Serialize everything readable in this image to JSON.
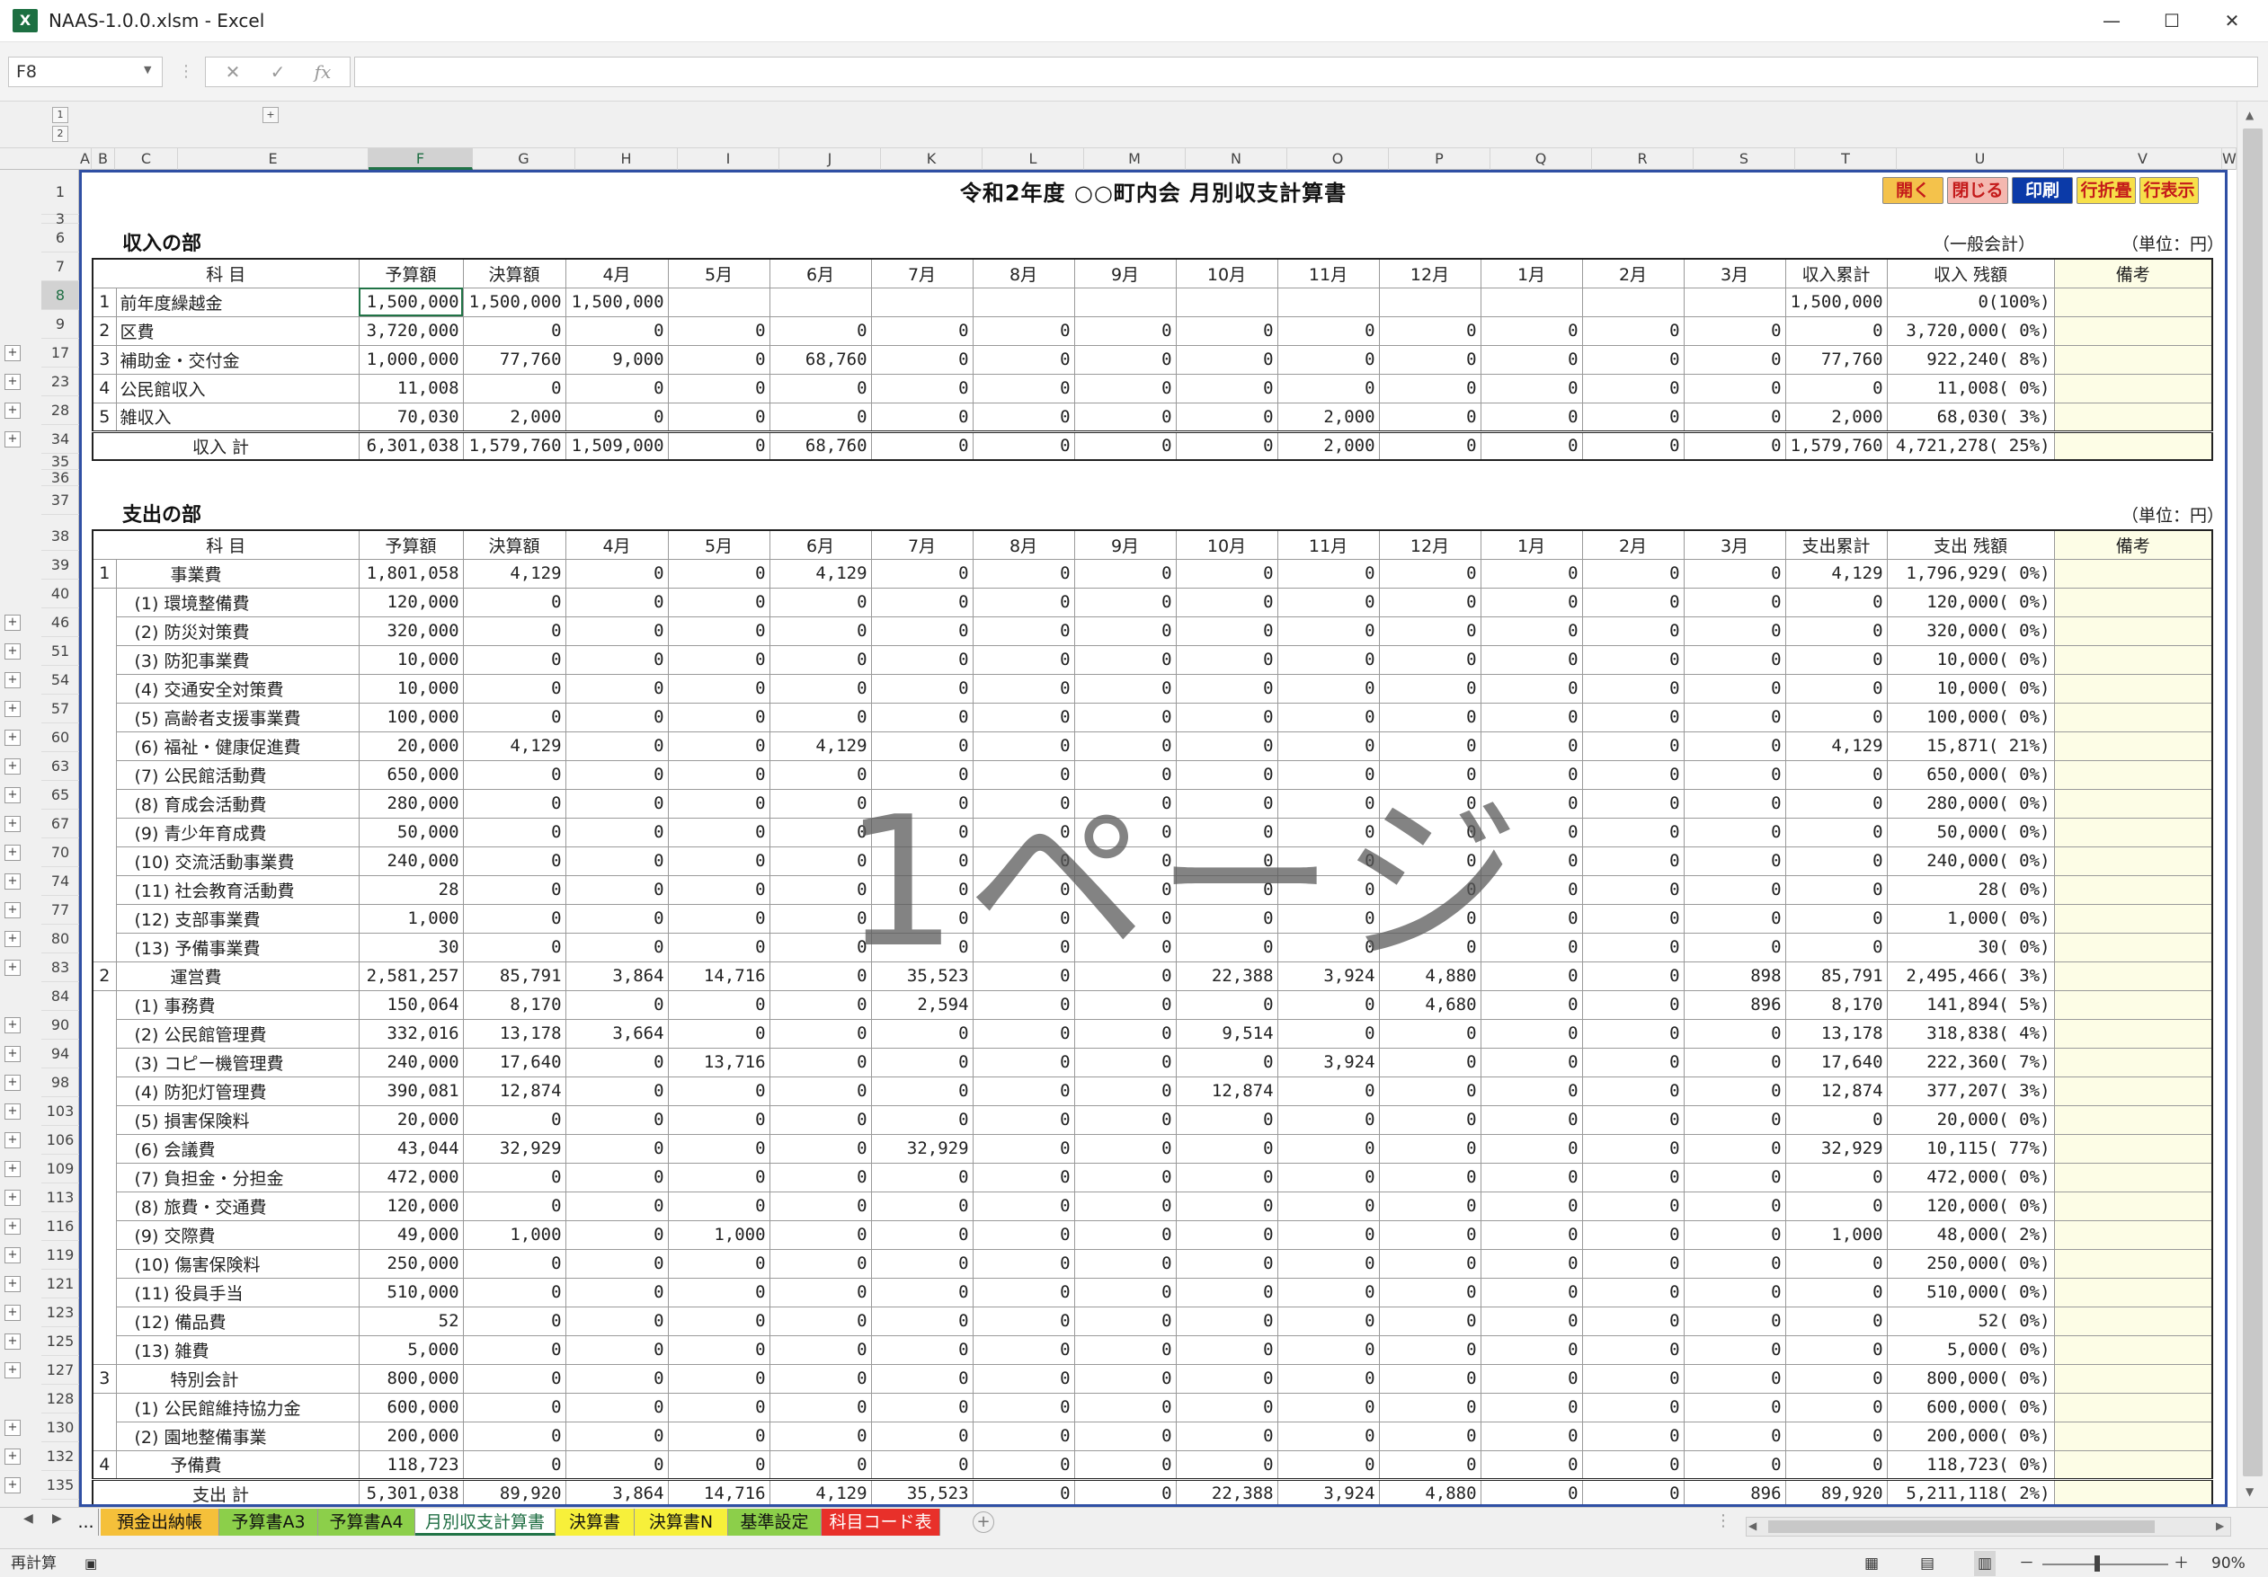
{
  "window": {
    "title": "NAAS-1.0.0.xlsm - Excel",
    "app_icon": "X",
    "minimize": "—",
    "maximize": "☐",
    "close": "✕"
  },
  "formula": {
    "namebox": "F8",
    "cancel": "✕",
    "enter": "✓",
    "fx": "fx",
    "value": ""
  },
  "outline": {
    "levels": [
      "1",
      "2"
    ],
    "col_plus": "+"
  },
  "columns": [
    "A",
    "B",
    "C",
    "E",
    "F",
    "G",
    "H",
    "I",
    "J",
    "K",
    "L",
    "M",
    "N",
    "O",
    "P",
    "Q",
    "R",
    "S",
    "T",
    "U",
    "V",
    "W"
  ],
  "selected_col": "F",
  "title": "令和2年度 ○○町内会 月別収支計算書",
  "macro_buttons": [
    {
      "label": "開く",
      "color": "#f4c24b",
      "text": "#c41a1a"
    },
    {
      "label": "閉じる",
      "color": "#f4b8b0",
      "text": "#c41a1a"
    },
    {
      "label": "印刷",
      "color": "#0b3aa8",
      "text": "#ffffff"
    },
    {
      "label": "行折畳",
      "color": "#f7e04a",
      "text": "#c41a1a"
    },
    {
      "label": "行表示",
      "color": "#f7e04a",
      "text": "#c41a1a"
    }
  ],
  "income": {
    "section": "収入の部",
    "account": "（一般会計）",
    "unit": "（単位：円）",
    "header": [
      "科 目",
      "予算額",
      "決算額",
      "4月",
      "5月",
      "6月",
      "7月",
      "8月",
      "9月",
      "10月",
      "11月",
      "12月",
      "1月",
      "2月",
      "3月",
      "収入累計",
      "収入 残額",
      "備考"
    ],
    "rows": [
      {
        "row": "8",
        "no": "1",
        "label": "前年度繰越金",
        "vals": [
          "1,500,000",
          "1,500,000",
          "1,500,000",
          "",
          "",
          "",
          "",
          "",
          "",
          "",
          "",
          "",
          "",
          ""
        ],
        "cum": "1,500,000",
        "rem": "0(100%)"
      },
      {
        "row": "9",
        "no": "2",
        "label": "区費",
        "vals": [
          "3,720,000",
          "0",
          "0",
          "0",
          "0",
          "0",
          "0",
          "0",
          "0",
          "0",
          "0",
          "0",
          "0",
          "0"
        ],
        "cum": "0",
        "rem": "3,720,000( 0%)"
      },
      {
        "row": "17",
        "no": "3",
        "label": "補助金・交付金",
        "vals": [
          "1,000,000",
          "77,760",
          "9,000",
          "0",
          "68,760",
          "0",
          "0",
          "0",
          "0",
          "0",
          "0",
          "0",
          "0",
          "0"
        ],
        "cum": "77,760",
        "rem": "922,240( 8%)"
      },
      {
        "row": "23",
        "no": "4",
        "label": "公民館収入",
        "vals": [
          "11,008",
          "0",
          "0",
          "0",
          "0",
          "0",
          "0",
          "0",
          "0",
          "0",
          "0",
          "0",
          "0",
          "0"
        ],
        "cum": "0",
        "rem": "11,008( 0%)"
      },
      {
        "row": "28",
        "no": "5",
        "label": "雑収入",
        "vals": [
          "70,030",
          "2,000",
          "0",
          "0",
          "0",
          "0",
          "0",
          "0",
          "0",
          "2,000",
          "0",
          "0",
          "0",
          "0"
        ],
        "cum": "2,000",
        "rem": "68,030( 3%)"
      }
    ],
    "total": {
      "row": "34",
      "label": "収入 計",
      "vals": [
        "6,301,038",
        "1,579,760",
        "1,509,000",
        "0",
        "68,760",
        "0",
        "0",
        "0",
        "0",
        "2,000",
        "0",
        "0",
        "0",
        "0"
      ],
      "cum": "1,579,760",
      "rem": "4,721,278( 25%)"
    }
  },
  "expense": {
    "section": "支出の部",
    "unit": "（単位：円）",
    "header": [
      "科 目",
      "予算額",
      "決算額",
      "4月",
      "5月",
      "6月",
      "7月",
      "8月",
      "9月",
      "10月",
      "11月",
      "12月",
      "1月",
      "2月",
      "3月",
      "支出累計",
      "支出 残額",
      "備考"
    ],
    "rows": [
      {
        "row": "39",
        "no": "1",
        "label": "事業費",
        "lvl": 0,
        "vals": [
          "1,801,058",
          "4,129",
          "0",
          "0",
          "4,129",
          "0",
          "0",
          "0",
          "0",
          "0",
          "0",
          "0",
          "0",
          "0"
        ],
        "cum": "4,129",
        "rem": "1,796,929( 0%)"
      },
      {
        "row": "40",
        "no": "",
        "label": "(1) 環境整備費",
        "lvl": 1,
        "vals": [
          "120,000",
          "0",
          "0",
          "0",
          "0",
          "0",
          "0",
          "0",
          "0",
          "0",
          "0",
          "0",
          "0",
          "0"
        ],
        "cum": "0",
        "rem": "120,000( 0%)"
      },
      {
        "row": "46",
        "no": "",
        "label": "(2) 防災対策費",
        "lvl": 1,
        "vals": [
          "320,000",
          "0",
          "0",
          "0",
          "0",
          "0",
          "0",
          "0",
          "0",
          "0",
          "0",
          "0",
          "0",
          "0"
        ],
        "cum": "0",
        "rem": "320,000( 0%)"
      },
      {
        "row": "51",
        "no": "",
        "label": "(3) 防犯事業費",
        "lvl": 1,
        "vals": [
          "10,000",
          "0",
          "0",
          "0",
          "0",
          "0",
          "0",
          "0",
          "0",
          "0",
          "0",
          "0",
          "0",
          "0"
        ],
        "cum": "0",
        "rem": "10,000( 0%)"
      },
      {
        "row": "54",
        "no": "",
        "label": "(4) 交通安全対策費",
        "lvl": 1,
        "vals": [
          "10,000",
          "0",
          "0",
          "0",
          "0",
          "0",
          "0",
          "0",
          "0",
          "0",
          "0",
          "0",
          "0",
          "0"
        ],
        "cum": "0",
        "rem": "10,000( 0%)"
      },
      {
        "row": "57",
        "no": "",
        "label": "(5) 高齢者支援事業費",
        "lvl": 1,
        "vals": [
          "100,000",
          "0",
          "0",
          "0",
          "0",
          "0",
          "0",
          "0",
          "0",
          "0",
          "0",
          "0",
          "0",
          "0"
        ],
        "cum": "0",
        "rem": "100,000( 0%)"
      },
      {
        "row": "60",
        "no": "",
        "label": "(6) 福祉・健康促進費",
        "lvl": 1,
        "vals": [
          "20,000",
          "4,129",
          "0",
          "0",
          "4,129",
          "0",
          "0",
          "0",
          "0",
          "0",
          "0",
          "0",
          "0",
          "0"
        ],
        "cum": "4,129",
        "rem": "15,871( 21%)"
      },
      {
        "row": "63",
        "no": "",
        "label": "(7) 公民館活動費",
        "lvl": 1,
        "vals": [
          "650,000",
          "0",
          "0",
          "0",
          "0",
          "0",
          "0",
          "0",
          "0",
          "0",
          "0",
          "0",
          "0",
          "0"
        ],
        "cum": "0",
        "rem": "650,000( 0%)"
      },
      {
        "row": "65",
        "no": "",
        "label": "(8) 育成会活動費",
        "lvl": 1,
        "vals": [
          "280,000",
          "0",
          "0",
          "0",
          "0",
          "0",
          "0",
          "0",
          "0",
          "0",
          "0",
          "0",
          "0",
          "0"
        ],
        "cum": "0",
        "rem": "280,000( 0%)"
      },
      {
        "row": "67",
        "no": "",
        "label": "(9) 青少年育成費",
        "lvl": 1,
        "vals": [
          "50,000",
          "0",
          "0",
          "0",
          "0",
          "0",
          "0",
          "0",
          "0",
          "0",
          "0",
          "0",
          "0",
          "0"
        ],
        "cum": "0",
        "rem": "50,000( 0%)"
      },
      {
        "row": "70",
        "no": "",
        "label": "(10) 交流活動事業費",
        "lvl": 1,
        "vals": [
          "240,000",
          "0",
          "0",
          "0",
          "0",
          "0",
          "0",
          "0",
          "0",
          "0",
          "0",
          "0",
          "0",
          "0"
        ],
        "cum": "0",
        "rem": "240,000( 0%)"
      },
      {
        "row": "74",
        "no": "",
        "label": "(11) 社会教育活動費",
        "lvl": 1,
        "vals": [
          "28",
          "0",
          "0",
          "0",
          "0",
          "0",
          "0",
          "0",
          "0",
          "0",
          "0",
          "0",
          "0",
          "0"
        ],
        "cum": "0",
        "rem": "28( 0%)"
      },
      {
        "row": "77",
        "no": "",
        "label": "(12) 支部事業費",
        "lvl": 1,
        "vals": [
          "1,000",
          "0",
          "0",
          "0",
          "0",
          "0",
          "0",
          "0",
          "0",
          "0",
          "0",
          "0",
          "0",
          "0"
        ],
        "cum": "0",
        "rem": "1,000( 0%)"
      },
      {
        "row": "80",
        "no": "",
        "label": "(13) 予備事業費",
        "lvl": 1,
        "vals": [
          "30",
          "0",
          "0",
          "0",
          "0",
          "0",
          "0",
          "0",
          "0",
          "0",
          "0",
          "0",
          "0",
          "0"
        ],
        "cum": "0",
        "rem": "30( 0%)"
      },
      {
        "row": "83",
        "no": "2",
        "label": "運営費",
        "lvl": 0,
        "vals": [
          "2,581,257",
          "85,791",
          "3,864",
          "14,716",
          "0",
          "35,523",
          "0",
          "0",
          "22,388",
          "3,924",
          "4,880",
          "0",
          "0",
          "898"
        ],
        "cum": "85,791",
        "rem": "2,495,466( 3%)"
      },
      {
        "row": "84",
        "no": "",
        "label": "(1) 事務費",
        "lvl": 1,
        "vals": [
          "150,064",
          "8,170",
          "0",
          "0",
          "0",
          "2,594",
          "0",
          "0",
          "0",
          "0",
          "4,680",
          "0",
          "0",
          "896"
        ],
        "cum": "8,170",
        "rem": "141,894( 5%)"
      },
      {
        "row": "90",
        "no": "",
        "label": "(2) 公民館管理費",
        "lvl": 1,
        "vals": [
          "332,016",
          "13,178",
          "3,664",
          "0",
          "0",
          "0",
          "0",
          "0",
          "9,514",
          "0",
          "0",
          "0",
          "0",
          "0"
        ],
        "cum": "13,178",
        "rem": "318,838( 4%)"
      },
      {
        "row": "94",
        "no": "",
        "label": "(3) コピー機管理費",
        "lvl": 1,
        "vals": [
          "240,000",
          "17,640",
          "0",
          "13,716",
          "0",
          "0",
          "0",
          "0",
          "0",
          "3,924",
          "0",
          "0",
          "0",
          "0"
        ],
        "cum": "17,640",
        "rem": "222,360( 7%)"
      },
      {
        "row": "98",
        "no": "",
        "label": "(4) 防犯灯管理費",
        "lvl": 1,
        "vals": [
          "390,081",
          "12,874",
          "0",
          "0",
          "0",
          "0",
          "0",
          "0",
          "12,874",
          "0",
          "0",
          "0",
          "0",
          "0"
        ],
        "cum": "12,874",
        "rem": "377,207( 3%)"
      },
      {
        "row": "103",
        "no": "",
        "label": "(5) 損害保険料",
        "lvl": 1,
        "vals": [
          "20,000",
          "0",
          "0",
          "0",
          "0",
          "0",
          "0",
          "0",
          "0",
          "0",
          "0",
          "0",
          "0",
          "0"
        ],
        "cum": "0",
        "rem": "20,000( 0%)"
      },
      {
        "row": "106",
        "no": "",
        "label": "(6) 会議費",
        "lvl": 1,
        "vals": [
          "43,044",
          "32,929",
          "0",
          "0",
          "0",
          "32,929",
          "0",
          "0",
          "0",
          "0",
          "0",
          "0",
          "0",
          "0"
        ],
        "cum": "32,929",
        "rem": "10,115( 77%)"
      },
      {
        "row": "109",
        "no": "",
        "label": "(7) 負担金・分担金",
        "lvl": 1,
        "vals": [
          "472,000",
          "0",
          "0",
          "0",
          "0",
          "0",
          "0",
          "0",
          "0",
          "0",
          "0",
          "0",
          "0",
          "0"
        ],
        "cum": "0",
        "rem": "472,000( 0%)"
      },
      {
        "row": "113",
        "no": "",
        "label": "(8) 旅費・交通費",
        "lvl": 1,
        "vals": [
          "120,000",
          "0",
          "0",
          "0",
          "0",
          "0",
          "0",
          "0",
          "0",
          "0",
          "0",
          "0",
          "0",
          "0"
        ],
        "cum": "0",
        "rem": "120,000( 0%)"
      },
      {
        "row": "116",
        "no": "",
        "label": "(9) 交際費",
        "lvl": 1,
        "vals": [
          "49,000",
          "1,000",
          "0",
          "1,000",
          "0",
          "0",
          "0",
          "0",
          "0",
          "0",
          "0",
          "0",
          "0",
          "0"
        ],
        "cum": "1,000",
        "rem": "48,000( 2%)"
      },
      {
        "row": "119",
        "no": "",
        "label": "(10) 傷害保険料",
        "lvl": 1,
        "vals": [
          "250,000",
          "0",
          "0",
          "0",
          "0",
          "0",
          "0",
          "0",
          "0",
          "0",
          "0",
          "0",
          "0",
          "0"
        ],
        "cum": "0",
        "rem": "250,000( 0%)"
      },
      {
        "row": "121",
        "no": "",
        "label": "(11) 役員手当",
        "lvl": 1,
        "vals": [
          "510,000",
          "0",
          "0",
          "0",
          "0",
          "0",
          "0",
          "0",
          "0",
          "0",
          "0",
          "0",
          "0",
          "0"
        ],
        "cum": "0",
        "rem": "510,000( 0%)"
      },
      {
        "row": "123",
        "no": "",
        "label": "(12) 備品費",
        "lvl": 1,
        "vals": [
          "52",
          "0",
          "0",
          "0",
          "0",
          "0",
          "0",
          "0",
          "0",
          "0",
          "0",
          "0",
          "0",
          "0"
        ],
        "cum": "0",
        "rem": "52( 0%)"
      },
      {
        "row": "125",
        "no": "",
        "label": "(13) 雑費",
        "lvl": 1,
        "vals": [
          "5,000",
          "0",
          "0",
          "0",
          "0",
          "0",
          "0",
          "0",
          "0",
          "0",
          "0",
          "0",
          "0",
          "0"
        ],
        "cum": "0",
        "rem": "5,000( 0%)"
      },
      {
        "row": "127",
        "no": "3",
        "label": "特別会計",
        "lvl": 0,
        "vals": [
          "800,000",
          "0",
          "0",
          "0",
          "0",
          "0",
          "0",
          "0",
          "0",
          "0",
          "0",
          "0",
          "0",
          "0"
        ],
        "cum": "0",
        "rem": "800,000( 0%)"
      },
      {
        "row": "128",
        "no": "",
        "label": "(1) 公民館維持協力金",
        "lvl": 1,
        "vals": [
          "600,000",
          "0",
          "0",
          "0",
          "0",
          "0",
          "0",
          "0",
          "0",
          "0",
          "0",
          "0",
          "0",
          "0"
        ],
        "cum": "0",
        "rem": "600,000( 0%)"
      },
      {
        "row": "130",
        "no": "",
        "label": "(2) 園地整備事業",
        "lvl": 1,
        "vals": [
          "200,000",
          "0",
          "0",
          "0",
          "0",
          "0",
          "0",
          "0",
          "0",
          "0",
          "0",
          "0",
          "0",
          "0"
        ],
        "cum": "0",
        "rem": "200,000( 0%)"
      },
      {
        "row": "132",
        "no": "4",
        "label": "予備費",
        "lvl": 0,
        "vals": [
          "118,723",
          "0",
          "0",
          "0",
          "0",
          "0",
          "0",
          "0",
          "0",
          "0",
          "0",
          "0",
          "0",
          "0"
        ],
        "cum": "0",
        "rem": "118,723( 0%)"
      }
    ],
    "total": {
      "row": "135",
      "label": "支出 計",
      "vals": [
        "5,301,038",
        "89,920",
        "3,864",
        "14,716",
        "4,129",
        "35,523",
        "0",
        "0",
        "22,388",
        "3,924",
        "4,880",
        "0",
        "0",
        "896"
      ],
      "cum": "89,920",
      "rem": "5,211,118( 2%)"
    }
  },
  "watermark": "1ページ",
  "tabs": [
    {
      "label": "...",
      "color": "#f0f0f0"
    },
    {
      "label": "預金出納帳",
      "color": "#f5c03a"
    },
    {
      "label": "予算書A3",
      "color": "#8ccf4a"
    },
    {
      "label": "予算書A4",
      "color": "#8ccf4a"
    },
    {
      "label": "月別収支計算書",
      "color": "#ffffff",
      "active": true
    },
    {
      "label": "決算書",
      "color": "#f7f03a"
    },
    {
      "label": "決算書N",
      "color": "#f7f03a"
    },
    {
      "label": "基準設定",
      "color": "#8ccf4a"
    },
    {
      "label": "科目コード表",
      "color": "#e8302a",
      "text": "#ffffff"
    }
  ],
  "status": {
    "mode": "再計算",
    "zoom": "90%",
    "zoom_minus": "－",
    "zoom_plus": "＋"
  }
}
